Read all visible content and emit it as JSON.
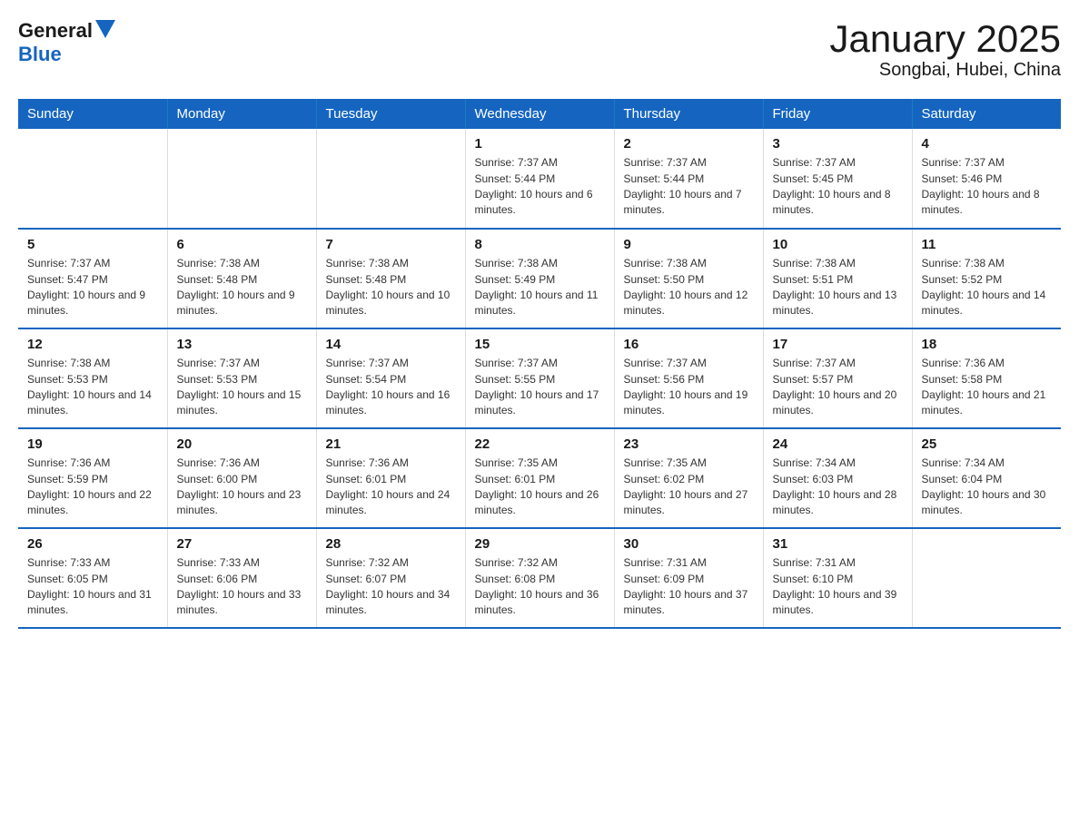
{
  "logo": {
    "general": "General",
    "blue": "Blue"
  },
  "title": "January 2025",
  "subtitle": "Songbai, Hubei, China",
  "days_of_week": [
    "Sunday",
    "Monday",
    "Tuesday",
    "Wednesday",
    "Thursday",
    "Friday",
    "Saturday"
  ],
  "weeks": [
    [
      {
        "day": "",
        "info": ""
      },
      {
        "day": "",
        "info": ""
      },
      {
        "day": "",
        "info": ""
      },
      {
        "day": "1",
        "info": "Sunrise: 7:37 AM\nSunset: 5:44 PM\nDaylight: 10 hours and 6 minutes."
      },
      {
        "day": "2",
        "info": "Sunrise: 7:37 AM\nSunset: 5:44 PM\nDaylight: 10 hours and 7 minutes."
      },
      {
        "day": "3",
        "info": "Sunrise: 7:37 AM\nSunset: 5:45 PM\nDaylight: 10 hours and 8 minutes."
      },
      {
        "day": "4",
        "info": "Sunrise: 7:37 AM\nSunset: 5:46 PM\nDaylight: 10 hours and 8 minutes."
      }
    ],
    [
      {
        "day": "5",
        "info": "Sunrise: 7:37 AM\nSunset: 5:47 PM\nDaylight: 10 hours and 9 minutes."
      },
      {
        "day": "6",
        "info": "Sunrise: 7:38 AM\nSunset: 5:48 PM\nDaylight: 10 hours and 9 minutes."
      },
      {
        "day": "7",
        "info": "Sunrise: 7:38 AM\nSunset: 5:48 PM\nDaylight: 10 hours and 10 minutes."
      },
      {
        "day": "8",
        "info": "Sunrise: 7:38 AM\nSunset: 5:49 PM\nDaylight: 10 hours and 11 minutes."
      },
      {
        "day": "9",
        "info": "Sunrise: 7:38 AM\nSunset: 5:50 PM\nDaylight: 10 hours and 12 minutes."
      },
      {
        "day": "10",
        "info": "Sunrise: 7:38 AM\nSunset: 5:51 PM\nDaylight: 10 hours and 13 minutes."
      },
      {
        "day": "11",
        "info": "Sunrise: 7:38 AM\nSunset: 5:52 PM\nDaylight: 10 hours and 14 minutes."
      }
    ],
    [
      {
        "day": "12",
        "info": "Sunrise: 7:38 AM\nSunset: 5:53 PM\nDaylight: 10 hours and 14 minutes."
      },
      {
        "day": "13",
        "info": "Sunrise: 7:37 AM\nSunset: 5:53 PM\nDaylight: 10 hours and 15 minutes."
      },
      {
        "day": "14",
        "info": "Sunrise: 7:37 AM\nSunset: 5:54 PM\nDaylight: 10 hours and 16 minutes."
      },
      {
        "day": "15",
        "info": "Sunrise: 7:37 AM\nSunset: 5:55 PM\nDaylight: 10 hours and 17 minutes."
      },
      {
        "day": "16",
        "info": "Sunrise: 7:37 AM\nSunset: 5:56 PM\nDaylight: 10 hours and 19 minutes."
      },
      {
        "day": "17",
        "info": "Sunrise: 7:37 AM\nSunset: 5:57 PM\nDaylight: 10 hours and 20 minutes."
      },
      {
        "day": "18",
        "info": "Sunrise: 7:36 AM\nSunset: 5:58 PM\nDaylight: 10 hours and 21 minutes."
      }
    ],
    [
      {
        "day": "19",
        "info": "Sunrise: 7:36 AM\nSunset: 5:59 PM\nDaylight: 10 hours and 22 minutes."
      },
      {
        "day": "20",
        "info": "Sunrise: 7:36 AM\nSunset: 6:00 PM\nDaylight: 10 hours and 23 minutes."
      },
      {
        "day": "21",
        "info": "Sunrise: 7:36 AM\nSunset: 6:01 PM\nDaylight: 10 hours and 24 minutes."
      },
      {
        "day": "22",
        "info": "Sunrise: 7:35 AM\nSunset: 6:01 PM\nDaylight: 10 hours and 26 minutes."
      },
      {
        "day": "23",
        "info": "Sunrise: 7:35 AM\nSunset: 6:02 PM\nDaylight: 10 hours and 27 minutes."
      },
      {
        "day": "24",
        "info": "Sunrise: 7:34 AM\nSunset: 6:03 PM\nDaylight: 10 hours and 28 minutes."
      },
      {
        "day": "25",
        "info": "Sunrise: 7:34 AM\nSunset: 6:04 PM\nDaylight: 10 hours and 30 minutes."
      }
    ],
    [
      {
        "day": "26",
        "info": "Sunrise: 7:33 AM\nSunset: 6:05 PM\nDaylight: 10 hours and 31 minutes."
      },
      {
        "day": "27",
        "info": "Sunrise: 7:33 AM\nSunset: 6:06 PM\nDaylight: 10 hours and 33 minutes."
      },
      {
        "day": "28",
        "info": "Sunrise: 7:32 AM\nSunset: 6:07 PM\nDaylight: 10 hours and 34 minutes."
      },
      {
        "day": "29",
        "info": "Sunrise: 7:32 AM\nSunset: 6:08 PM\nDaylight: 10 hours and 36 minutes."
      },
      {
        "day": "30",
        "info": "Sunrise: 7:31 AM\nSunset: 6:09 PM\nDaylight: 10 hours and 37 minutes."
      },
      {
        "day": "31",
        "info": "Sunrise: 7:31 AM\nSunset: 6:10 PM\nDaylight: 10 hours and 39 minutes."
      },
      {
        "day": "",
        "info": ""
      }
    ]
  ]
}
